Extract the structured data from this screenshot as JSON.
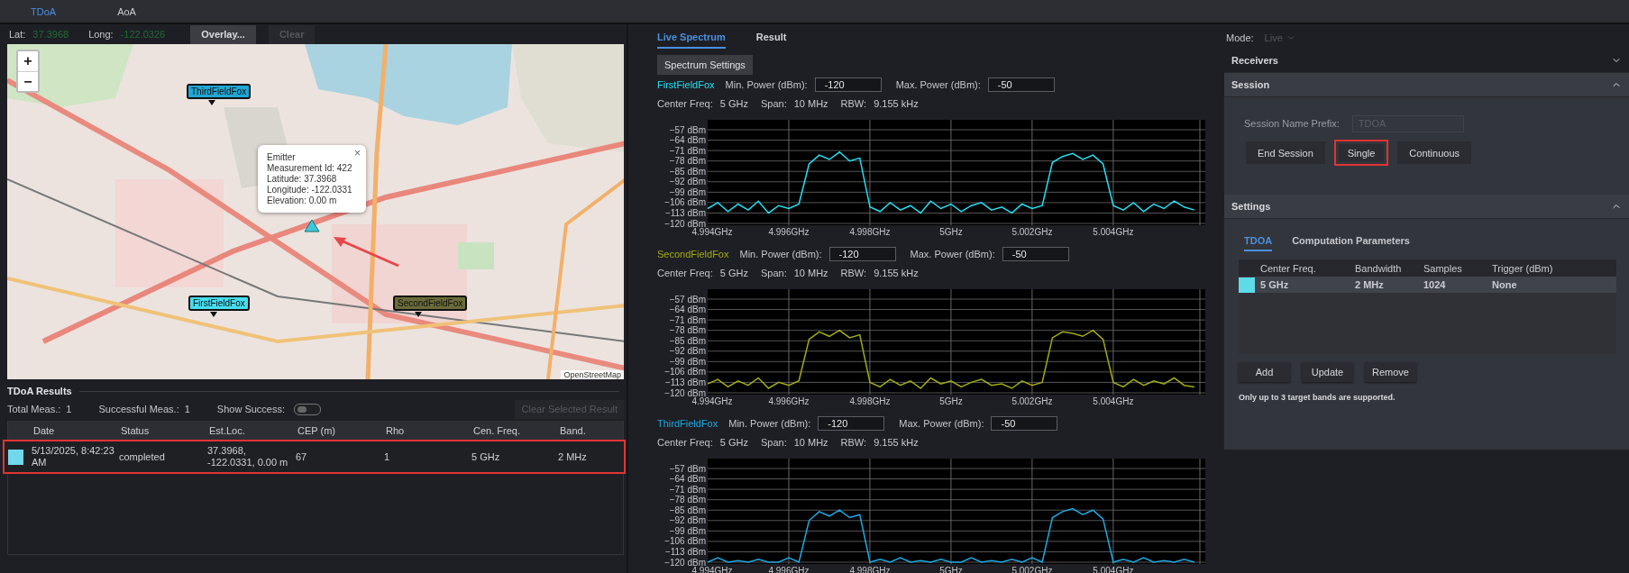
{
  "top_tabs": [
    {
      "label": "TDoA",
      "selected": true
    },
    {
      "label": "AoA",
      "selected": false
    }
  ],
  "map_panel": {
    "lat_label": "Lat:",
    "lat_value": "37.3968",
    "long_label": "Long:",
    "long_value": "-122.0326",
    "buttons": [
      {
        "label": "Overlay...",
        "disabled": false
      },
      {
        "label": "Clear",
        "disabled": true
      }
    ],
    "map": {
      "zoom_in": "+",
      "zoom_out": "−",
      "markers": [
        {
          "label": "ThirdFieldFox",
          "color": "#1fa6d4"
        },
        {
          "label": "FirstFieldFox",
          "color": "#45def0"
        },
        {
          "label": "SecondFieldFox",
          "color": "#6b6b3a"
        }
      ],
      "popup": {
        "close": "×",
        "lines": [
          "Emitter",
          "Measurement Id: 422",
          "Latitude: 37.3968",
          "Longitude: -122.0331",
          "Elevation: 0.00 m"
        ]
      },
      "attribution": "OpenStreetMap"
    }
  },
  "results": {
    "title": "TDoA Results",
    "stats": [
      {
        "label": "Total Meas.:",
        "value": "1"
      },
      {
        "label": "Successful Meas.:",
        "value": "1"
      }
    ],
    "show_success": {
      "label": "Show Success:",
      "on": false
    },
    "clear_button": {
      "label": "Clear Selected Result",
      "disabled": true
    },
    "columns": [
      "Date",
      "Status",
      "Est.Loc.",
      "CEP (m)",
      "Rho",
      "Cen. Freq.",
      "Band."
    ],
    "rows": [
      {
        "color": "#6fd8ea",
        "highlighted": true,
        "cells": [
          "5/13/2025, 8:42:23 AM",
          "completed",
          "37.3968, -122.0331, 0.00 m",
          "67",
          "1",
          "5 GHz",
          "2 MHz"
        ]
      }
    ]
  },
  "spectrum": {
    "tabs": [
      {
        "label": "Live Spectrum",
        "selected": true
      },
      {
        "label": "Result",
        "selected": false
      }
    ],
    "settings_button": "Spectrum Settings",
    "receivers": [
      {
        "name": "FirstFieldFox",
        "min_label": "Min. Power (dBm):",
        "min_value": "-120",
        "max_label": "Max. Power (dBm):",
        "max_value": "-50",
        "info": [
          {
            "label": "Center Freq:",
            "value": "5 GHz"
          },
          {
            "label": "Span:",
            "value": "10 MHz"
          },
          {
            "label": "RBW:",
            "value": "9.155 kHz"
          }
        ],
        "chart_data": {
          "type": "line",
          "grid": true,
          "xlim": [
            4.994,
            5.00627
          ],
          "ylim": [
            -120,
            -57
          ],
          "x": [
            4.994,
            4.99425,
            4.9945,
            4.99475,
            4.995,
            4.99525,
            4.9955,
            4.99575,
            4.996,
            4.99625,
            4.9965,
            4.99675,
            4.997,
            4.99725,
            4.9975,
            4.99775,
            4.998,
            4.99825,
            4.9985,
            4.99875,
            4.999,
            4.99925,
            4.9995,
            4.99975,
            5,
            5.00025,
            5.0005,
            5.00075,
            5.001,
            5.00125,
            5.0015,
            5.00175,
            5.002,
            5.00225,
            5.0025,
            5.00275,
            5.003,
            5.00325,
            5.0035,
            5.00375,
            5.004,
            5.00425,
            5.0045,
            5.00475,
            5.005,
            5.00525,
            5.0055,
            5.00575,
            5.006
          ],
          "xticks": [
            {
              "value": 4.994,
              "label": "4.994GHz"
            },
            {
              "value": 4.996,
              "label": "4.996GHz"
            },
            {
              "value": 4.998,
              "label": "4.998GHz"
            },
            {
              "value": 5,
              "label": "5GHz"
            },
            {
              "value": 5.002,
              "label": "5.002GHz"
            },
            {
              "value": 5.004,
              "label": "5.004GHz"
            }
          ],
          "yticks": [
            {
              "value": -57,
              "label": "−57 dBm"
            },
            {
              "value": -64,
              "label": "−64 dBm"
            },
            {
              "value": -71,
              "label": "−71 dBm"
            },
            {
              "value": -78,
              "label": "−78 dBm"
            },
            {
              "value": -85,
              "label": "−85 dBm"
            },
            {
              "value": -92,
              "label": "−92 dBm"
            },
            {
              "value": -99,
              "label": "−99 dBm"
            },
            {
              "value": -106,
              "label": "−106 dBm"
            },
            {
              "value": -113,
              "label": "−113 dBm"
            },
            {
              "value": -120,
              "label": "−120 dBm"
            }
          ],
          "series": [
            {
              "color": "#22e0f2",
              "values": [
                -110,
                -106,
                -112,
                -107,
                -111,
                -105,
                -113,
                -108,
                -110,
                -107,
                -80,
                -74,
                -77,
                -72,
                -78,
                -76,
                -109,
                -112,
                -106,
                -111,
                -108,
                -113,
                -105,
                -110,
                -107,
                -112,
                -108,
                -106,
                -111,
                -109,
                -113,
                -107,
                -110,
                -108,
                -79,
                -75,
                -73,
                -77,
                -74,
                -80,
                -108,
                -111,
                -106,
                -112,
                -107,
                -110,
                -105,
                -109,
                -111
              ]
            }
          ]
        }
      },
      {
        "name": "SecondFieldFox",
        "min_label": "Min. Power (dBm):",
        "min_value": "-120",
        "max_label": "Max. Power (dBm):",
        "max_value": "-50",
        "info": [
          {
            "label": "Center Freq:",
            "value": "5 GHz"
          },
          {
            "label": "Span:",
            "value": "10 MHz"
          },
          {
            "label": "RBW:",
            "value": "9.155 kHz"
          }
        ],
        "chart_data": {
          "type": "line",
          "grid": true,
          "xlim": [
            4.994,
            5.00627
          ],
          "ylim": [
            -120,
            -57
          ],
          "x": [
            4.994,
            4.99425,
            4.9945,
            4.99475,
            4.995,
            4.99525,
            4.9955,
            4.99575,
            4.996,
            4.99625,
            4.9965,
            4.99675,
            4.997,
            4.99725,
            4.9975,
            4.99775,
            4.998,
            4.99825,
            4.9985,
            4.99875,
            4.999,
            4.99925,
            4.9995,
            4.99975,
            5,
            5.00025,
            5.0005,
            5.00075,
            5.001,
            5.00125,
            5.0015,
            5.00175,
            5.002,
            5.00225,
            5.0025,
            5.00275,
            5.003,
            5.00325,
            5.0035,
            5.00375,
            5.004,
            5.00425,
            5.0045,
            5.00475,
            5.005,
            5.00525,
            5.0055,
            5.00575,
            5.006
          ],
          "xticks": [
            {
              "value": 4.994,
              "label": "4.994GHz"
            },
            {
              "value": 4.996,
              "label": "4.996GHz"
            },
            {
              "value": 4.998,
              "label": "4.998GHz"
            },
            {
              "value": 5,
              "label": "5GHz"
            },
            {
              "value": 5.002,
              "label": "5.002GHz"
            },
            {
              "value": 5.004,
              "label": "5.004GHz"
            }
          ],
          "yticks": [
            {
              "value": -57,
              "label": "−57 dBm"
            },
            {
              "value": -64,
              "label": "−64 dBm"
            },
            {
              "value": -71,
              "label": "−71 dBm"
            },
            {
              "value": -78,
              "label": "−78 dBm"
            },
            {
              "value": -85,
              "label": "−85 dBm"
            },
            {
              "value": -92,
              "label": "−92 dBm"
            },
            {
              "value": -99,
              "label": "−99 dBm"
            },
            {
              "value": -106,
              "label": "−106 dBm"
            },
            {
              "value": -113,
              "label": "−113 dBm"
            },
            {
              "value": -120,
              "label": "−120 dBm"
            }
          ],
          "series": [
            {
              "color": "#a3ab14",
              "values": [
                -114,
                -111,
                -116,
                -112,
                -115,
                -110,
                -117,
                -113,
                -115,
                -112,
                -84,
                -79,
                -82,
                -78,
                -83,
                -81,
                -113,
                -116,
                -111,
                -115,
                -112,
                -117,
                -110,
                -114,
                -112,
                -116,
                -113,
                -111,
                -115,
                -114,
                -117,
                -112,
                -115,
                -113,
                -83,
                -79,
                -80,
                -82,
                -78,
                -84,
                -113,
                -116,
                -111,
                -115,
                -112,
                -114,
                -110,
                -115,
                -116
              ]
            }
          ]
        }
      },
      {
        "name": "ThirdFieldFox",
        "min_label": "Min. Power (dBm):",
        "min_value": "-120",
        "max_label": "Max. Power (dBm):",
        "max_value": "-50",
        "info": [
          {
            "label": "Center Freq:",
            "value": "5 GHz"
          },
          {
            "label": "Span:",
            "value": "10 MHz"
          },
          {
            "label": "RBW:",
            "value": "9.155 kHz"
          }
        ],
        "chart_data": {
          "type": "line",
          "grid": true,
          "xlim": [
            4.994,
            5.00627
          ],
          "ylim": [
            -120,
            -57
          ],
          "x": [
            4.994,
            4.99425,
            4.9945,
            4.99475,
            4.995,
            4.99525,
            4.9955,
            4.99575,
            4.996,
            4.99625,
            4.9965,
            4.99675,
            4.997,
            4.99725,
            4.9975,
            4.99775,
            4.998,
            4.99825,
            4.9985,
            4.99875,
            4.999,
            4.99925,
            4.9995,
            4.99975,
            5,
            5.00025,
            5.0005,
            5.00075,
            5.001,
            5.00125,
            5.0015,
            5.00175,
            5.002,
            5.00225,
            5.0025,
            5.00275,
            5.003,
            5.00325,
            5.0035,
            5.00375,
            5.004,
            5.00425,
            5.0045,
            5.00475,
            5.005,
            5.00525,
            5.0055,
            5.00575,
            5.006
          ],
          "xticks": [
            {
              "value": 4.994,
              "label": "4.994GHz"
            },
            {
              "value": 4.996,
              "label": "4.996GHz"
            },
            {
              "value": 4.998,
              "label": "4.998GHz"
            },
            {
              "value": 5,
              "label": "5GHz"
            },
            {
              "value": 5.002,
              "label": "5.002GHz"
            },
            {
              "value": 5.004,
              "label": "5.004GHz"
            }
          ],
          "yticks": [
            {
              "value": -57,
              "label": "−57 dBm"
            },
            {
              "value": -64,
              "label": "−64 dBm"
            },
            {
              "value": -71,
              "label": "−71 dBm"
            },
            {
              "value": -78,
              "label": "−78 dBm"
            },
            {
              "value": -85,
              "label": "−85 dBm"
            },
            {
              "value": -92,
              "label": "−92 dBm"
            },
            {
              "value": -99,
              "label": "−99 dBm"
            },
            {
              "value": -106,
              "label": "−106 dBm"
            },
            {
              "value": -113,
              "label": "−113 dBm"
            },
            {
              "value": -120,
              "label": "−120 dBm"
            }
          ],
          "series": [
            {
              "color": "#1ca9e2",
              "values": [
                -120,
                -117,
                -120,
                -119,
                -120,
                -118,
                -120,
                -120,
                -117,
                -120,
                -92,
                -86,
                -89,
                -85,
                -90,
                -88,
                -120,
                -118,
                -120,
                -117,
                -120,
                -119,
                -120,
                -118,
                -120,
                -120,
                -117,
                -120,
                -119,
                -120,
                -118,
                -120,
                -117,
                -120,
                -90,
                -86,
                -84,
                -88,
                -85,
                -91,
                -120,
                -118,
                -120,
                -117,
                -120,
                -119,
                -120,
                -118,
                -120
              ]
            }
          ]
        }
      }
    ]
  },
  "side_panel": {
    "mode": {
      "label": "Mode:",
      "value": "Live"
    },
    "receivers": {
      "title": "Receivers",
      "expanded": false
    },
    "session": {
      "title": "Session",
      "expanded": true,
      "prefix_label": "Session Name Prefix:",
      "prefix_placeholder": "TDOA",
      "buttons": [
        {
          "label": "End Session",
          "highlighted": false
        },
        {
          "label": "Single",
          "highlighted": true
        },
        {
          "label": "Continuous",
          "highlighted": false
        }
      ]
    },
    "settings": {
      "title": "Settings",
      "expanded": true,
      "tabs": [
        {
          "label": "TDOA",
          "selected": true
        },
        {
          "label": "Computation Parameters",
          "selected": false
        }
      ],
      "columns": [
        "Center Freq.",
        "Bandwidth",
        "Samples",
        "Trigger (dBm)"
      ],
      "rows": [
        {
          "color": "#5fdbe8",
          "cells": [
            "5 GHz",
            "2 MHz",
            "1024",
            "None"
          ]
        }
      ],
      "buttons": [
        "Add",
        "Update",
        "Remove"
      ],
      "note": "Only up to 3 target bands are supported."
    }
  }
}
